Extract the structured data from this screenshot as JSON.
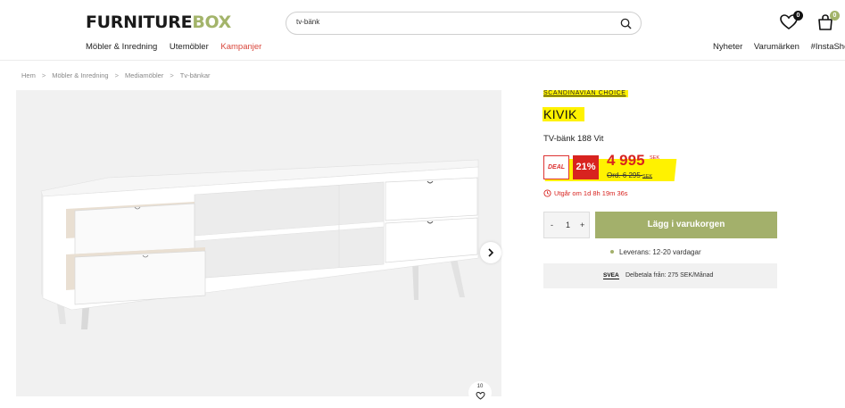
{
  "header": {
    "logo_main": "FURNITURE",
    "logo_accent": "BOX",
    "search_query": "tv-bänk",
    "wishlist_count": "0",
    "cart_count": "0",
    "nav_left": [
      "Möbler & Inredning",
      "Utemöbler",
      "Kampanjer"
    ],
    "nav_right": [
      "Nyheter",
      "Varumärken",
      "#InstaShop"
    ]
  },
  "breadcrumb": [
    "Hem",
    "Möbler & Inredning",
    "Mediamöbler",
    "Tv-bänkar"
  ],
  "gallery": {
    "favorites_count": "10"
  },
  "product": {
    "brand": "SCANDINAVIAN CHOICE",
    "title": "KIVIK",
    "subtitle": "TV-bänk 188 Vit",
    "deal_label": "DEAL",
    "discount": "21%",
    "price": "4 995",
    "currency": "SEK",
    "ord_price": "Ord. 6 295",
    "ord_currency": "SEK",
    "timer": "Utgår om 1d 8h 19m 36s",
    "quantity": "1",
    "qty_minus": "-",
    "qty_plus": "+",
    "add_to_cart": "Lägg i varukorgen",
    "delivery": "Leverans: 12-20 vardagar",
    "payment_logo": "SVEA",
    "payment_text": "Delbetala från: 275 SEK/Månad"
  },
  "colors": {
    "accent_green": "#a3b06b",
    "sale_red": "#d8231f",
    "highlight_yellow": "#fff200"
  },
  "icons": {
    "search": "search-icon",
    "wishlist": "heart-icon",
    "cart": "bag-icon",
    "next": "chevron-right-icon",
    "timer": "clock-icon"
  }
}
